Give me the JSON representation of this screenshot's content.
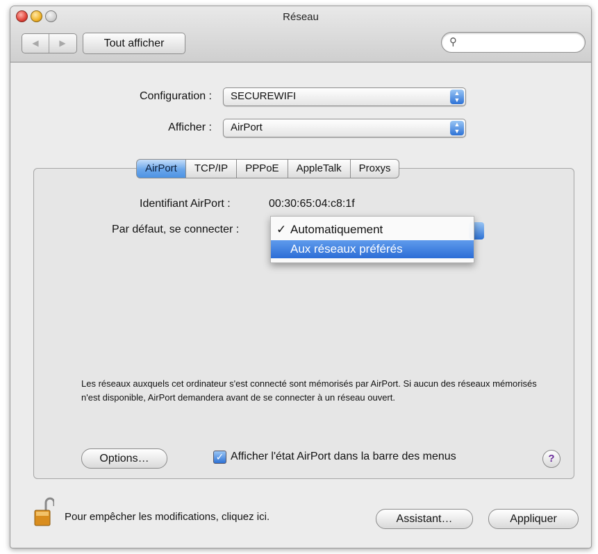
{
  "window": {
    "title": "Réseau"
  },
  "toolbar": {
    "back_glyph": "◀",
    "forward_glyph": "▶",
    "show_all_label": "Tout afficher",
    "search_placeholder": "",
    "search_icon": "magnifier-icon"
  },
  "configuration": {
    "label": "Configuration :",
    "value": "SECUREWIFI"
  },
  "show": {
    "label": "Afficher :",
    "value": "AirPort"
  },
  "tabs": [
    {
      "label": "AirPort",
      "active": true
    },
    {
      "label": "TCP/IP",
      "active": false
    },
    {
      "label": "PPPoE",
      "active": false
    },
    {
      "label": "AppleTalk",
      "active": false
    },
    {
      "label": "Proxys",
      "active": false
    }
  ],
  "airport": {
    "id_label": "Identifiant AirPort :",
    "id_value": "00:30:65:04:c8:1f",
    "connect_label": "Par défaut, se connecter :"
  },
  "connect_menu": {
    "items": [
      {
        "label": "Automatiquement",
        "checked": true,
        "highlighted": false
      },
      {
        "label": "Aux réseaux préférés",
        "checked": false,
        "highlighted": true
      }
    ],
    "check_glyph": "✓"
  },
  "description": "Les réseaux auxquels cet ordinateur s'est connecté sont mémorisés par AirPort. Si aucun des réseaux mémorisés n'est disponible, AirPort demandera avant de se connecter à un réseau ouvert.",
  "options_button": "Options…",
  "show_status": {
    "label": "Afficher l'état AirPort dans la barre des menus",
    "checked": true,
    "check_glyph": "✓"
  },
  "help_glyph": "?",
  "lock_text": "Pour empêcher les modifications, cliquez ici.",
  "assistant_button": "Assistant…",
  "apply_button": "Appliquer",
  "colors": {
    "accent": "#4d93e3",
    "highlight": "#2c6dd6",
    "window_bg": "#ececec"
  }
}
